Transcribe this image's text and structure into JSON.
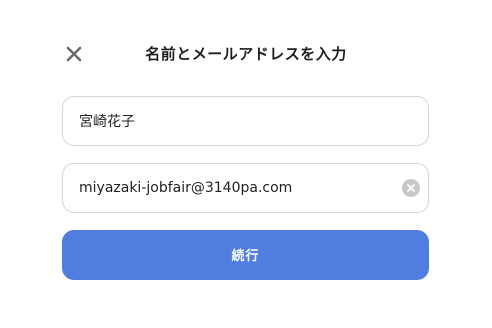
{
  "dialog": {
    "title": "名前とメールアドレスを入力",
    "close_icon": "close-icon"
  },
  "form": {
    "name_value": "宮崎花子",
    "email_value": "miyazaki-jobfair@3140pa.com",
    "clear_icon": "clear-circle-icon"
  },
  "actions": {
    "continue_label": "続行"
  },
  "colors": {
    "accent": "#4f7ee0",
    "field_border": "#d6d6d6",
    "clear_icon_fill": "#c8c8c8",
    "close_icon": "#6b6b6b"
  }
}
